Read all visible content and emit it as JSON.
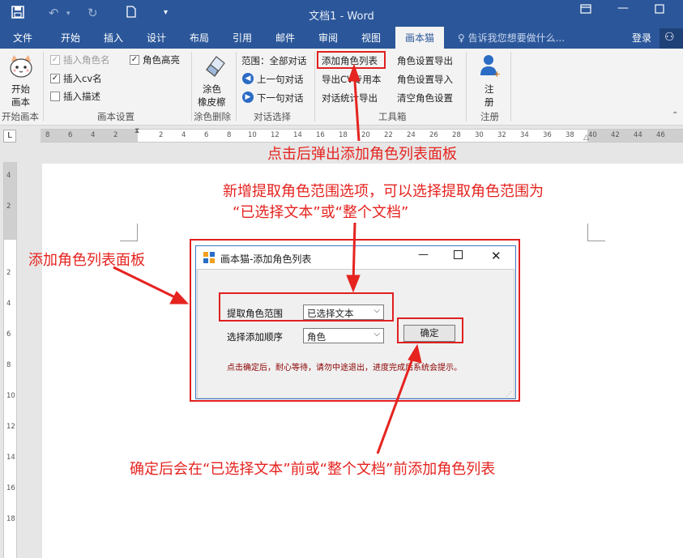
{
  "window": {
    "title": "文档1 - Word",
    "qa_save_icon": "save-icon",
    "qa_undo_icon": "undo-icon",
    "qa_redo_icon": "redo-icon",
    "qa_new_icon": "new-document-icon",
    "qa_customize_icon": "customize-icon"
  },
  "tabs": {
    "items": [
      "文件",
      "开始",
      "插入",
      "设计",
      "布局",
      "引用",
      "邮件",
      "审阅",
      "视图",
      "画本猫"
    ],
    "active": "画本猫",
    "tell_me": "告诉我您想要做什么...",
    "login": "登录",
    "share_short": "只"
  },
  "ribbon": {
    "start_script": {
      "line1": "开始",
      "line2": "画本",
      "group": "开始画本"
    },
    "script_settings": {
      "insert_role_name": "插入角色名",
      "insert_cv_name": "插入cv名",
      "insert_desc": "插入描述",
      "role_highlight": "角色高亮",
      "group": "画本设置"
    },
    "erase": {
      "line1": "涂色",
      "line2": "橡皮檫",
      "group": "涂色删除"
    },
    "dialog_select": {
      "range": "范围：全部对话",
      "prev": "上一句对话",
      "next": "下一句对话",
      "group": "对话选择"
    },
    "toolbox": {
      "add_role_list": "添加角色列表",
      "export_cv": "导出CV专用本",
      "dialog_stats": "对话统计导出",
      "role_export": "角色设置导出",
      "role_import": "角色设置导入",
      "role_clear": "清空角色设置",
      "group": "工具箱"
    },
    "register": {
      "line1": "注",
      "line2": "册",
      "group": "注册"
    }
  },
  "ruler": {
    "horizontal": [
      "8",
      "6",
      "4",
      "2",
      "2",
      "4",
      "6",
      "8",
      "10",
      "12",
      "14",
      "16",
      "18",
      "20",
      "22",
      "24",
      "26",
      "28",
      "30",
      "32",
      "34",
      "36",
      "38",
      "40",
      "42",
      "44",
      "46"
    ],
    "vertical": [
      "4",
      "2",
      "2",
      "4",
      "6",
      "8",
      "10",
      "12",
      "14",
      "16",
      "18"
    ]
  },
  "dialog": {
    "title": "画本猫-添加角色列表",
    "range_label": "提取角色范围",
    "range_value": "已选择文本",
    "order_label": "选择添加顺序",
    "order_value": "角色",
    "ok": "确定",
    "hint": "点击确定后，耐心等待，请勿中途退出，进度完成后系统会提示。"
  },
  "annotations": {
    "popup_note": "点击后弹出添加角色列表面板",
    "range_note_1": "新增提取角色范围选项，可以选择提取角色范围为",
    "range_note_2": "“已选择文本”或“整个文档”",
    "panel_note": "添加角色列表面板",
    "confirm_note": "确定后会在“已选择文本”前或“整个文档”前添加角色列表"
  },
  "colors": {
    "word_blue": "#2b579a",
    "annotation_red": "#e5231f"
  }
}
